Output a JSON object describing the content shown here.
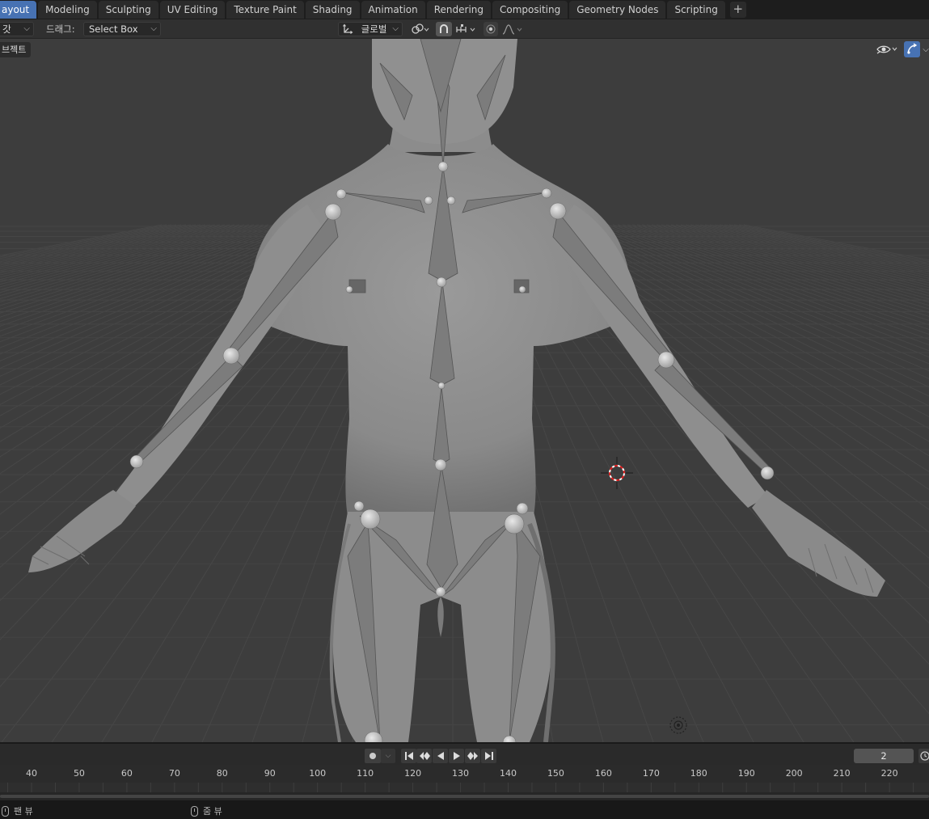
{
  "workspace_tabs": [
    {
      "label": "ayout",
      "active": true
    },
    {
      "label": "Modeling"
    },
    {
      "label": "Sculpting"
    },
    {
      "label": "UV Editing"
    },
    {
      "label": "Texture Paint"
    },
    {
      "label": "Shading"
    },
    {
      "label": "Animation"
    },
    {
      "label": "Rendering"
    },
    {
      "label": "Compositing"
    },
    {
      "label": "Geometry Nodes"
    },
    {
      "label": "Scripting"
    }
  ],
  "header": {
    "mode_partial": "갓",
    "drag_label": "드래그:",
    "select_mode": "Select Box",
    "transform_orientation": "글로벌"
  },
  "viewport": {
    "object_menu_partial": "브젝트"
  },
  "timeline": {
    "current_frame": "2",
    "ruler_ticks": [
      "40",
      "50",
      "60",
      "70",
      "80",
      "90",
      "100",
      "110",
      "120",
      "130",
      "140",
      "150",
      "160",
      "170",
      "180",
      "190",
      "200",
      "210",
      "220"
    ]
  },
  "status": {
    "pan_view": "팬 뷰",
    "zoom_view": "줌 뷰"
  },
  "colors": {
    "accent": "#4772b3",
    "viewport_bg": "#3d3d3d",
    "mesh": "#8f8f8f"
  }
}
